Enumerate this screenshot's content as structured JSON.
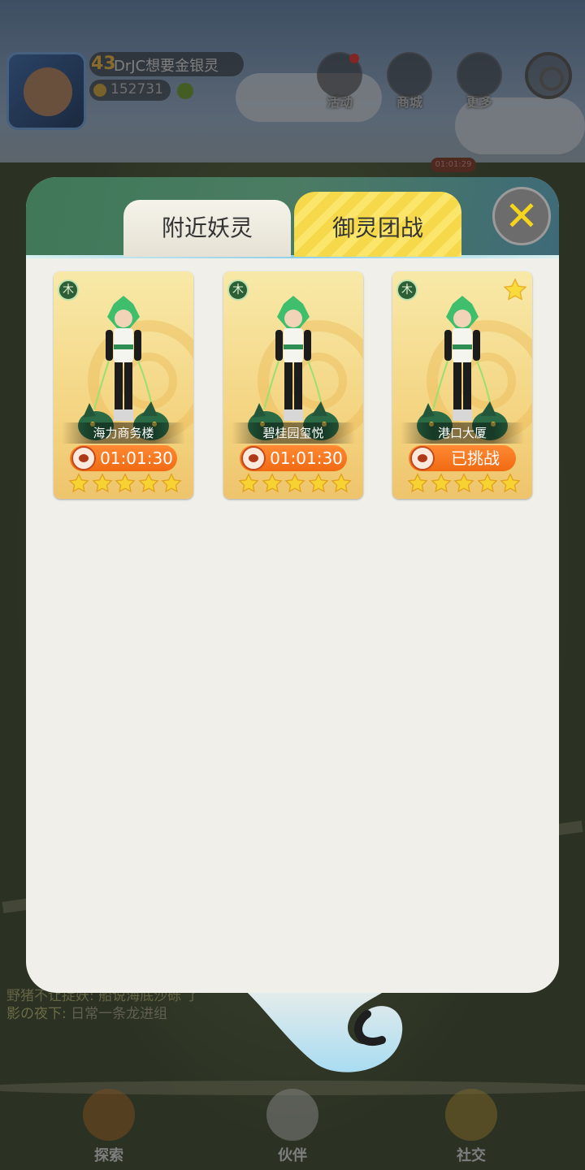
{
  "player": {
    "level": "43",
    "name": "DrJC想要金银灵",
    "currency": "152731"
  },
  "top_buttons": [
    {
      "label": "活动"
    },
    {
      "label": "商城"
    },
    {
      "label": "更多"
    }
  ],
  "map_timer": "01:01:29",
  "modal": {
    "tabs": [
      {
        "label": "附近妖灵",
        "active": false
      },
      {
        "label": "御灵团战",
        "active": true
      }
    ],
    "close_icon": "close-x-icon",
    "cards": [
      {
        "element": "木",
        "location": "海力商务楼",
        "status": "01:01:30",
        "stars": 5,
        "favorite": false
      },
      {
        "element": "木",
        "location": "碧桂园玺悦",
        "status": "01:01:30",
        "stars": 5,
        "favorite": false
      },
      {
        "element": "木",
        "location": "港口大厦",
        "status": "已挑战",
        "stars": 5,
        "favorite": true
      }
    ]
  },
  "chat": {
    "lines": [
      {
        "text": "野猪不让捉妖: 船说海底沙砾 了"
      },
      {
        "who": "影の夜下:",
        "msg": "日常一条龙进组"
      }
    ]
  },
  "bottom_nav": [
    {
      "label": "探索"
    },
    {
      "label": "伙伴"
    },
    {
      "label": "社交"
    }
  ],
  "colors": {
    "accent_tab": "#f6d94a",
    "status_orange": "#f06a13",
    "header_green": "#3f7858"
  }
}
